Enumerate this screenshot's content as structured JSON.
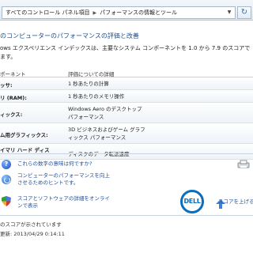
{
  "address_bar": {
    "crumb1": "すべてのコントロール パネル項目",
    "crumb2": "パフォーマンスの情報とツール"
  },
  "page": {
    "title": "のコンピューターのパフォーマンスの評価と改善",
    "description_line1": "ows エクスペリエンス インデックスは、主要なシステム コンポーネントを 1.0 から 7.9 のスコアで",
    "description_line2": "ます。"
  },
  "table": {
    "header_component": "ポーネント",
    "header_detail": "評価についての詳細",
    "rows": [
      {
        "label": "ッサ:",
        "detail": "1 秒あたりの計算"
      },
      {
        "label": "リ (RAM):",
        "detail": "1 秒あたりのメモリ操作"
      },
      {
        "label": "ィックス:",
        "detail": "Windows Aero のデスクトップ パフォーマンス"
      },
      {
        "label": "ム用グラフィックス:",
        "detail": "3D ビジネスおよびゲーム グラフィックス パフォーマンス"
      },
      {
        "label": "イマリ ハード ディス",
        "detail": "ディスクのデータ転送速度"
      }
    ]
  },
  "links": {
    "score_meaning": "これらの数字の意味は何ですか?",
    "improve_tips_1": "コンピューターのパフォーマンスを向上",
    "improve_tips_2": "させるためのヒントです。",
    "online_details_1": "スコアとソフトウェアの詳細をオンライ",
    "online_details_2": "ンで表示",
    "raise_score": "スコアを上げる方法"
  },
  "status": {
    "line1": "のスコアが示されています",
    "line2": "更新: 2013/04/29 0:14:11"
  },
  "brand": {
    "dell_label": "DELL"
  },
  "colors": {
    "link": "#1f4e99",
    "title": "#1e4f8a",
    "dell_blue": "#0a6ebd"
  },
  "icons": [
    "refresh-icon",
    "help-question-icon",
    "performance-tips-icon",
    "security-shield-icon",
    "dell-logo",
    "printer-icon"
  ]
}
